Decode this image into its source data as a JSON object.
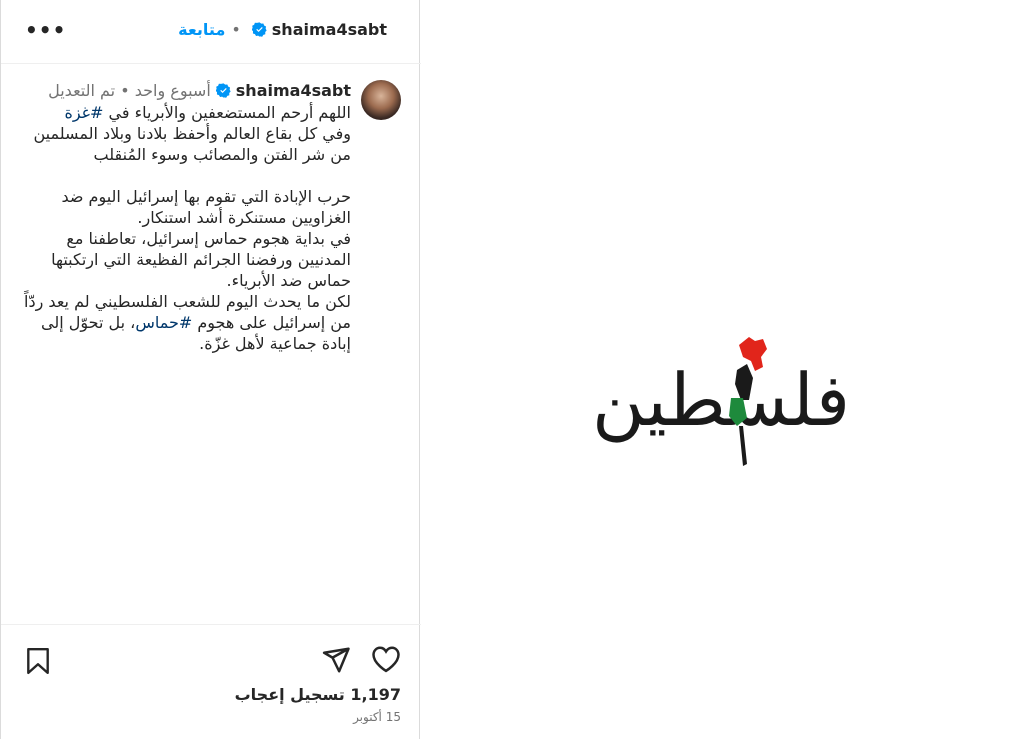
{
  "header": {
    "username": "shaima4sabt",
    "follow_label": "متابعة",
    "separator": "•",
    "more_label": "•••"
  },
  "caption": {
    "username": "shaima4sabt",
    "meta": "أسبوع واحد • تم التعديل",
    "text_line_1a": "اللهم أرحم المستضعفين والأبرياء في ",
    "hashtag_1": "#غزة",
    "text_line_1b": "\nوفي كل بقاع العالم وأحفظ بلادنا وبلاد المسلمين من شر الفتن والمصائب وسوء المُنقلب\n\nحرب الإبادة التي تقوم بها إسرائيل اليوم ضد الغزاويين مستنكرة أشد استنكار.\nفي بداية هجوم حماس إسرائيل، تعاطفنا مع المدنيين ورفضنا الجرائم الفظيعة التي ارتكبتها حماس ضد الأبرياء.\nلكن ما يحدث اليوم للشعب الفلسطيني لم يعد ردّاً من إسرائيل على هجوم ",
    "hashtag_2": "#حماس",
    "text_line_2": "، بل تحوّل إلى إبادة جماعية لأهل غزّة."
  },
  "footer": {
    "likes": "1,197 تسجيل إعجاب",
    "date": "15 أكتوبر"
  },
  "media": {
    "calligraphy": "فلسطين",
    "colors": {
      "black": "#1a1a1a",
      "green": "#1e8a3c",
      "red": "#e1251b",
      "accent": "#0095f6"
    }
  }
}
